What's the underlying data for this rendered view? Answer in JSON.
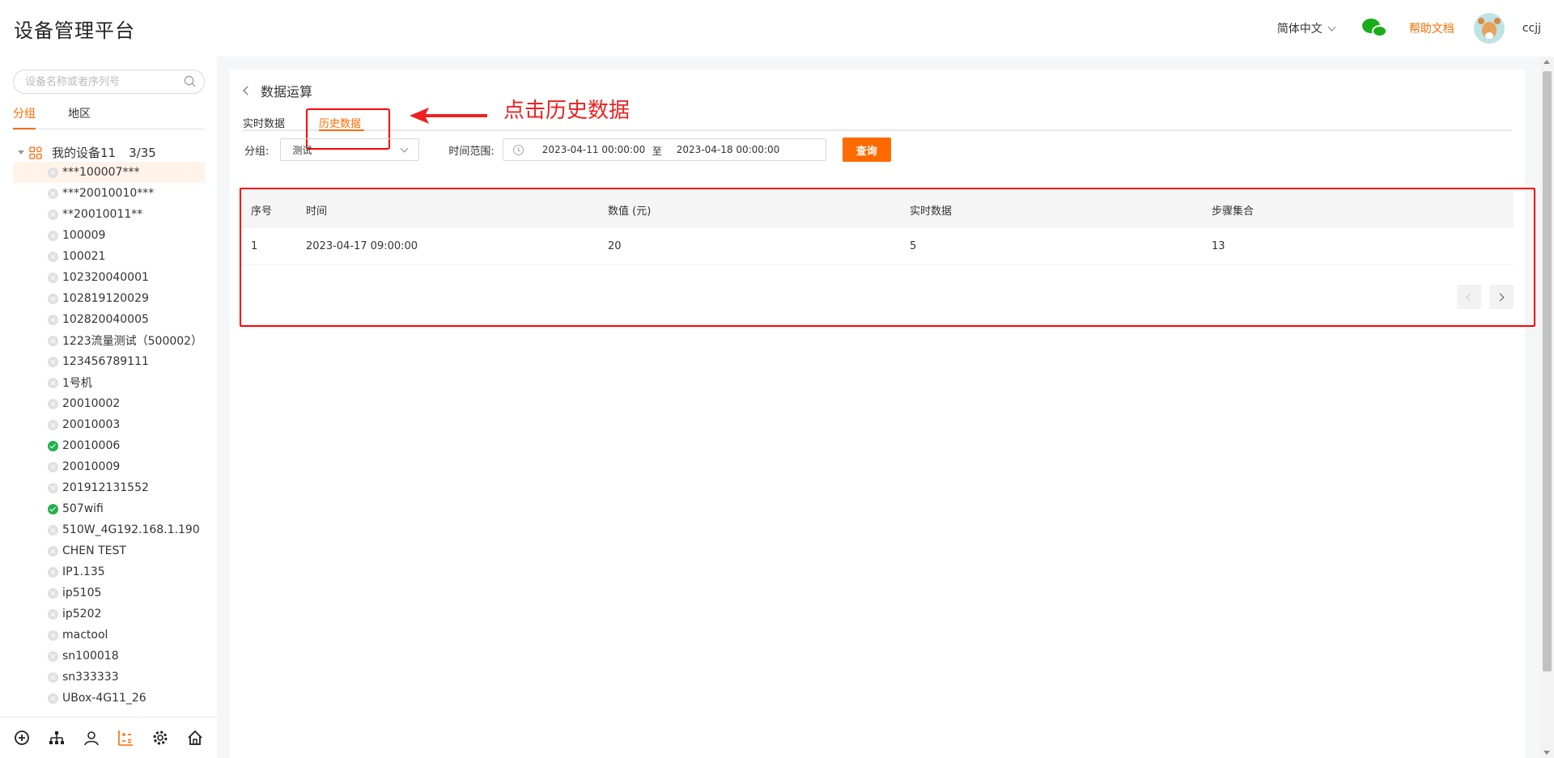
{
  "header": {
    "title": "设备管理平台",
    "language": "简体中文",
    "help": "帮助文档",
    "username": "ccjj"
  },
  "sidebar": {
    "search_placeholder": "设备名称或者序列号",
    "tabs": [
      "分组",
      "地区"
    ],
    "group_name": "我的设备11",
    "group_count": "3/35",
    "devices": [
      {
        "name": "***100007***",
        "online": false,
        "selected": true
      },
      {
        "name": "***20010010***",
        "online": false
      },
      {
        "name": "**20010011**",
        "online": false
      },
      {
        "name": "100009",
        "online": false
      },
      {
        "name": "100021",
        "online": false
      },
      {
        "name": "102320040001",
        "online": false
      },
      {
        "name": "102819120029",
        "online": false
      },
      {
        "name": "102820040005",
        "online": false
      },
      {
        "name": "1223流量测试（500002）",
        "online": false
      },
      {
        "name": "123456789111",
        "online": false
      },
      {
        "name": "1号机",
        "online": false
      },
      {
        "name": "20010002",
        "online": false
      },
      {
        "name": "20010003",
        "online": false
      },
      {
        "name": "20010006",
        "online": true
      },
      {
        "name": "20010009",
        "online": false
      },
      {
        "name": "201912131552",
        "online": false
      },
      {
        "name": "507wifi",
        "online": true
      },
      {
        "name": "510W_4G192.168.1.190",
        "online": false
      },
      {
        "name": "CHEN TEST",
        "online": false
      },
      {
        "name": "IP1.135",
        "online": false
      },
      {
        "name": "ip5105",
        "online": false
      },
      {
        "name": "ip5202",
        "online": false
      },
      {
        "name": "mactool",
        "online": false
      },
      {
        "name": "sn100018",
        "online": false
      },
      {
        "name": "sn333333",
        "online": false
      },
      {
        "name": "UBox-4G11_26",
        "online": false
      }
    ],
    "bottom_icons": [
      "add-circle-icon",
      "org-tree-icon",
      "user-icon",
      "data-calc-icon",
      "settings-icon",
      "home-icon"
    ]
  },
  "main": {
    "breadcrumb": "数据运算",
    "tabs": [
      "实时数据",
      "历史数据"
    ],
    "active_tab": 1,
    "annotation": "点击历史数据",
    "filter": {
      "group_label": "分组:",
      "group_value": "测试",
      "range_label": "时间范围:",
      "range_start": "2023-04-11 00:00:00",
      "range_sep": "至",
      "range_end": "2023-04-18 00:00:00",
      "query_button": "查询"
    },
    "table": {
      "columns": [
        "序号",
        "时间",
        "数值 (元)",
        "实时数据",
        "步骤集合"
      ],
      "rows": [
        [
          "1",
          "2023-04-17 09:00:00",
          "20",
          "5",
          "13"
        ]
      ]
    }
  },
  "colors": {
    "accent": "#ff6a00",
    "annotation": "#f02020",
    "online": "#22b14c"
  }
}
